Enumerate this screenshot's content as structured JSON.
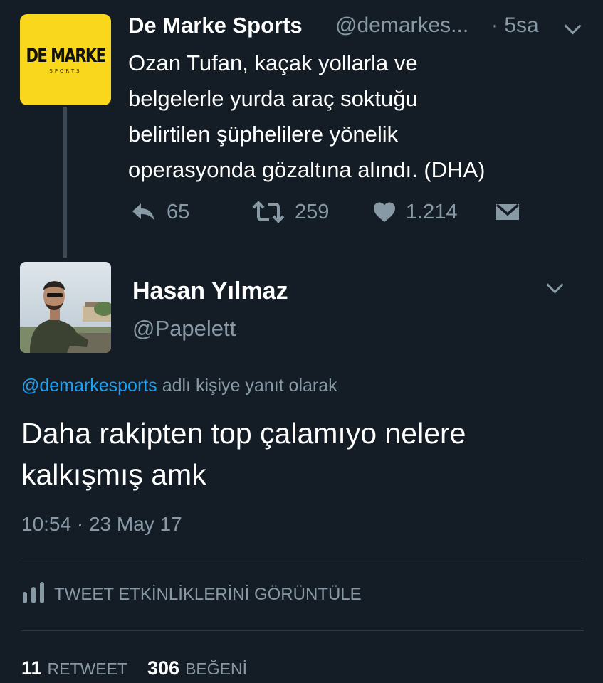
{
  "quoted_tweet": {
    "avatar_brand": "DE MARKE",
    "avatar_brand_sub": "SPORTS",
    "display_name": "De Marke Sports",
    "handle": "@demarkes...",
    "time": "· 5sa",
    "text": "Ozan Tufan, kaçak yollarla ve\nbelgelerle yurda araç soktuğu\nbelirtilen şüphelilere yönelik\noperasyonda gözaltına alındı. (DHA)",
    "actions": {
      "replies": "65",
      "retweets": "259",
      "likes": "1.214"
    },
    "icons": [
      "reply-icon",
      "retweet-icon",
      "heart-icon",
      "envelope-icon",
      "chevron-down-icon"
    ]
  },
  "tweet": {
    "display_name": "Hasan Yılmaz",
    "handle": "@Papelett",
    "reply_mention": "@demarkesports",
    "reply_suffix": "adlı kişiye yanıt olarak",
    "text": "Daha rakipten top çalamıyo nelere\nkalkışmış amk",
    "timestamp": "10:54 · 23 May 17",
    "activity_label": "TWEET ETKİNLİKLERİNİ GÖRÜNTÜLE",
    "stats": {
      "retweet_count": "11",
      "retweet_label": "RETWEET",
      "like_count": "306",
      "like_label": "BEĞENİ"
    }
  },
  "colors": {
    "background": "#141d26",
    "text": "#ffffff",
    "secondary": "#8899a6",
    "link": "#1da1f2",
    "brand_yellow": "#f9d71c"
  }
}
